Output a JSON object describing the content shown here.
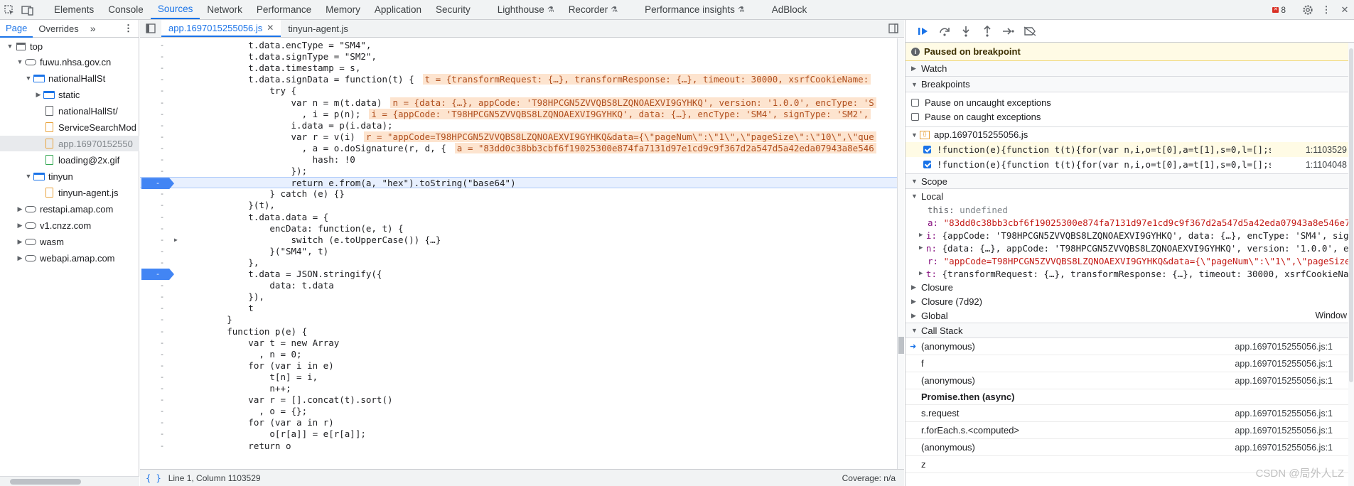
{
  "toolbar": {
    "tabs": [
      {
        "label": "Elements"
      },
      {
        "label": "Console"
      },
      {
        "label": "Sources"
      },
      {
        "label": "Network"
      },
      {
        "label": "Performance"
      },
      {
        "label": "Memory"
      },
      {
        "label": "Application"
      },
      {
        "label": "Security"
      },
      {
        "label": "Lighthouse"
      },
      {
        "label": "Recorder"
      },
      {
        "label": "Performance insights"
      },
      {
        "label": "AdBlock"
      }
    ],
    "active_tab": "Sources",
    "error_count": "8"
  },
  "navigator": {
    "tabs": [
      {
        "label": "Page"
      },
      {
        "label": "Overrides"
      }
    ],
    "tree": [
      {
        "label": "top"
      },
      {
        "label": "fuwu.nhsa.gov.cn"
      },
      {
        "label": "nationalHallSt"
      },
      {
        "label": "static"
      },
      {
        "label": "nationalHallSt/"
      },
      {
        "label": "ServiceSearchMod"
      },
      {
        "label": "app.16970152550"
      },
      {
        "label": "loading@2x.gif"
      },
      {
        "label": "tinyun"
      },
      {
        "label": "tinyun-agent.js"
      },
      {
        "label": "restapi.amap.com"
      },
      {
        "label": "v1.cnzz.com"
      },
      {
        "label": "wasm"
      },
      {
        "label": "webapi.amap.com"
      }
    ]
  },
  "editor": {
    "tabs": [
      {
        "label": "app.1697015255056.js"
      },
      {
        "label": "tinyun-agent.js"
      }
    ],
    "lines": [
      {
        "gutter": "-",
        "code": "            t.data.encType = \"SM4\",",
        "inline": ""
      },
      {
        "gutter": "-",
        "code": "            t.data.signType = \"SM2\",",
        "inline": ""
      },
      {
        "gutter": "-",
        "code": "            t.data.timestamp = s,",
        "inline": ""
      },
      {
        "gutter": "-",
        "code": "            t.data.signData = function(t) {",
        "inline": "t = {transformRequest: {…}, transformResponse: {…}, timeout: 30000, xsrfCookieName:"
      },
      {
        "gutter": "-",
        "code": "                try {",
        "inline": ""
      },
      {
        "gutter": "-",
        "code": "                    var n = m(t.data)",
        "inline": "n = {data: {…}, appCode: 'T98HPCGN5ZVVQBS8LZQNOAEXVI9GYHKQ', version: '1.0.0', encType: 'S"
      },
      {
        "gutter": "-",
        "code": "                      , i = p(n);",
        "inline": "i = {appCode: 'T98HPCGN5ZVVQBS8LZQNOAEXVI9GYHKQ', data: {…}, encType: 'SM4', signType: 'SM2',"
      },
      {
        "gutter": "-",
        "code": "                    i.data = p(i.data);",
        "inline": ""
      },
      {
        "gutter": "-",
        "code": "                    var r = v(i)",
        "inline": "r = \"appCode=T98HPCGN5ZVVQBS8LZQNOAEXVI9GYHKQ&data={\\\"pageNum\\\":\\\"1\\\",\\\"pageSize\\\":\\\"10\\\",\\\"que"
      },
      {
        "gutter": "-",
        "code": "                      , a = o.doSignature(r, d, {",
        "inline": "a = \"83dd0c38bb3cbf6f19025300e874fa7131d97e1cd9c9f367d2a547d5a42eda07943a8e546"
      },
      {
        "gutter": "-",
        "code": "                        hash: !0",
        "inline": ""
      },
      {
        "gutter": "-",
        "code": "                    });",
        "inline": ""
      },
      {
        "gutter": "-",
        "code": "                    return e.from(a, \"hex\").toString(\"base64\")",
        "inline": ""
      },
      {
        "gutter": "-",
        "code": "                } catch (e) {}",
        "inline": ""
      },
      {
        "gutter": "-",
        "code": "            }(t),",
        "inline": ""
      },
      {
        "gutter": "-",
        "code": "            t.data.data = {",
        "inline": ""
      },
      {
        "gutter": "-",
        "code": "                encData: function(e, t) {",
        "inline": ""
      },
      {
        "gutter": "-",
        "code": "                    switch (e.toUpperCase()) {…}",
        "inline": ""
      },
      {
        "gutter": "-",
        "code": "                }(\"SM4\", t)",
        "inline": ""
      },
      {
        "gutter": "-",
        "code": "            },",
        "inline": ""
      },
      {
        "gutter": "-",
        "code": "            t.data = JSON.stringify({",
        "inline": ""
      },
      {
        "gutter": "-",
        "code": "                data: t.data",
        "inline": ""
      },
      {
        "gutter": "-",
        "code": "            }),",
        "inline": ""
      },
      {
        "gutter": "-",
        "code": "            t",
        "inline": ""
      },
      {
        "gutter": "-",
        "code": "        }",
        "inline": ""
      },
      {
        "gutter": "-",
        "code": "        function p(e) {",
        "inline": ""
      },
      {
        "gutter": "-",
        "code": "            var t = new Array",
        "inline": ""
      },
      {
        "gutter": "-",
        "code": "              , n = 0;",
        "inline": ""
      },
      {
        "gutter": "-",
        "code": "            for (var i in e)",
        "inline": ""
      },
      {
        "gutter": "-",
        "code": "                t[n] = i,",
        "inline": ""
      },
      {
        "gutter": "-",
        "code": "                n++;",
        "inline": ""
      },
      {
        "gutter": "-",
        "code": "            var r = [].concat(t).sort()",
        "inline": ""
      },
      {
        "gutter": "-",
        "code": "              , o = {};",
        "inline": ""
      },
      {
        "gutter": "-",
        "code": "            for (var a in r)",
        "inline": ""
      },
      {
        "gutter": "-",
        "code": "                o[r[a]] = e[r[a]];",
        "inline": ""
      },
      {
        "gutter": "-",
        "code": "            return o",
        "inline": ""
      }
    ]
  },
  "status": {
    "braces": "{ }",
    "position": "Line 1, Column 1103529",
    "coverage": "Coverage: n/a"
  },
  "debugger": {
    "paused_text": "Paused on breakpoint",
    "sections": {
      "watch": "Watch",
      "breakpoints": "Breakpoints",
      "scope": "Scope",
      "call_stack": "Call Stack"
    },
    "pause_options": [
      {
        "label": "Pause on uncaught exceptions"
      },
      {
        "label": "Pause on caught exceptions"
      }
    ],
    "bp_file": "app.1697015255056.js",
    "breakpoints": [
      {
        "code": "!function(e){function t(t){for(var n,i,o=t[0],a=t[1],s=0,l=[];s<o...",
        "loc": "1:1103529"
      },
      {
        "code": "!function(e){function t(t){for(var n,i,o=t[0],a=t[1],s=0,l=[];s<o...",
        "loc": "1:1104048"
      }
    ],
    "scope": {
      "local_label": "Local",
      "vars": [
        {
          "name": "this:",
          "value": "undefined"
        },
        {
          "name": "a:",
          "value": "\"83dd0c38bb3cbf6f19025300e874fa7131d97e1cd9c9f367d2a547d5a42eda07943a8e546e7f"
        },
        {
          "name": "i:",
          "value": "{appCode: 'T98HPCGN5ZVVQBS8LZQNOAEXVI9GYHKQ', data: {…}, encType: 'SM4', sign"
        },
        {
          "name": "n:",
          "value": "{data: {…}, appCode: 'T98HPCGN5ZVVQBS8LZQNOAEXVI9GYHKQ', version: '1.0.0', en"
        },
        {
          "name": "r:",
          "value": "\"appCode=T98HPCGN5ZVVQBS8LZQNOAEXVI9GYHKQ&data={\\\"pageNum\\\":\\\"1\\\",\\\"pageSize\\"
        },
        {
          "name": "t:",
          "value": "{transformRequest: {…}, transformResponse: {…}, timeout: 30000, xsrfCookieNam"
        }
      ],
      "groups": [
        {
          "label": "Closure",
          "right": ""
        },
        {
          "label": "Closure (7d92)",
          "right": ""
        },
        {
          "label": "Global",
          "right": "Window"
        }
      ]
    },
    "call_stack": {
      "frames_a": [
        {
          "fn": "(anonymous)",
          "loc": "app.1697015255056.js:1"
        },
        {
          "fn": "f",
          "loc": "app.1697015255056.js:1"
        },
        {
          "fn": "(anonymous)",
          "loc": "app.1697015255056.js:1"
        }
      ],
      "async_label": "Promise.then (async)",
      "frames_b": [
        {
          "fn": "s.request",
          "loc": "app.1697015255056.js:1"
        },
        {
          "fn": "r.forEach.s.<computed>",
          "loc": "app.1697015255056.js:1"
        },
        {
          "fn": "(anonymous)",
          "loc": "app.1697015255056.js:1"
        },
        {
          "fn": "z",
          "loc": ""
        }
      ]
    }
  },
  "watermark": "CSDN @局外人LZ"
}
